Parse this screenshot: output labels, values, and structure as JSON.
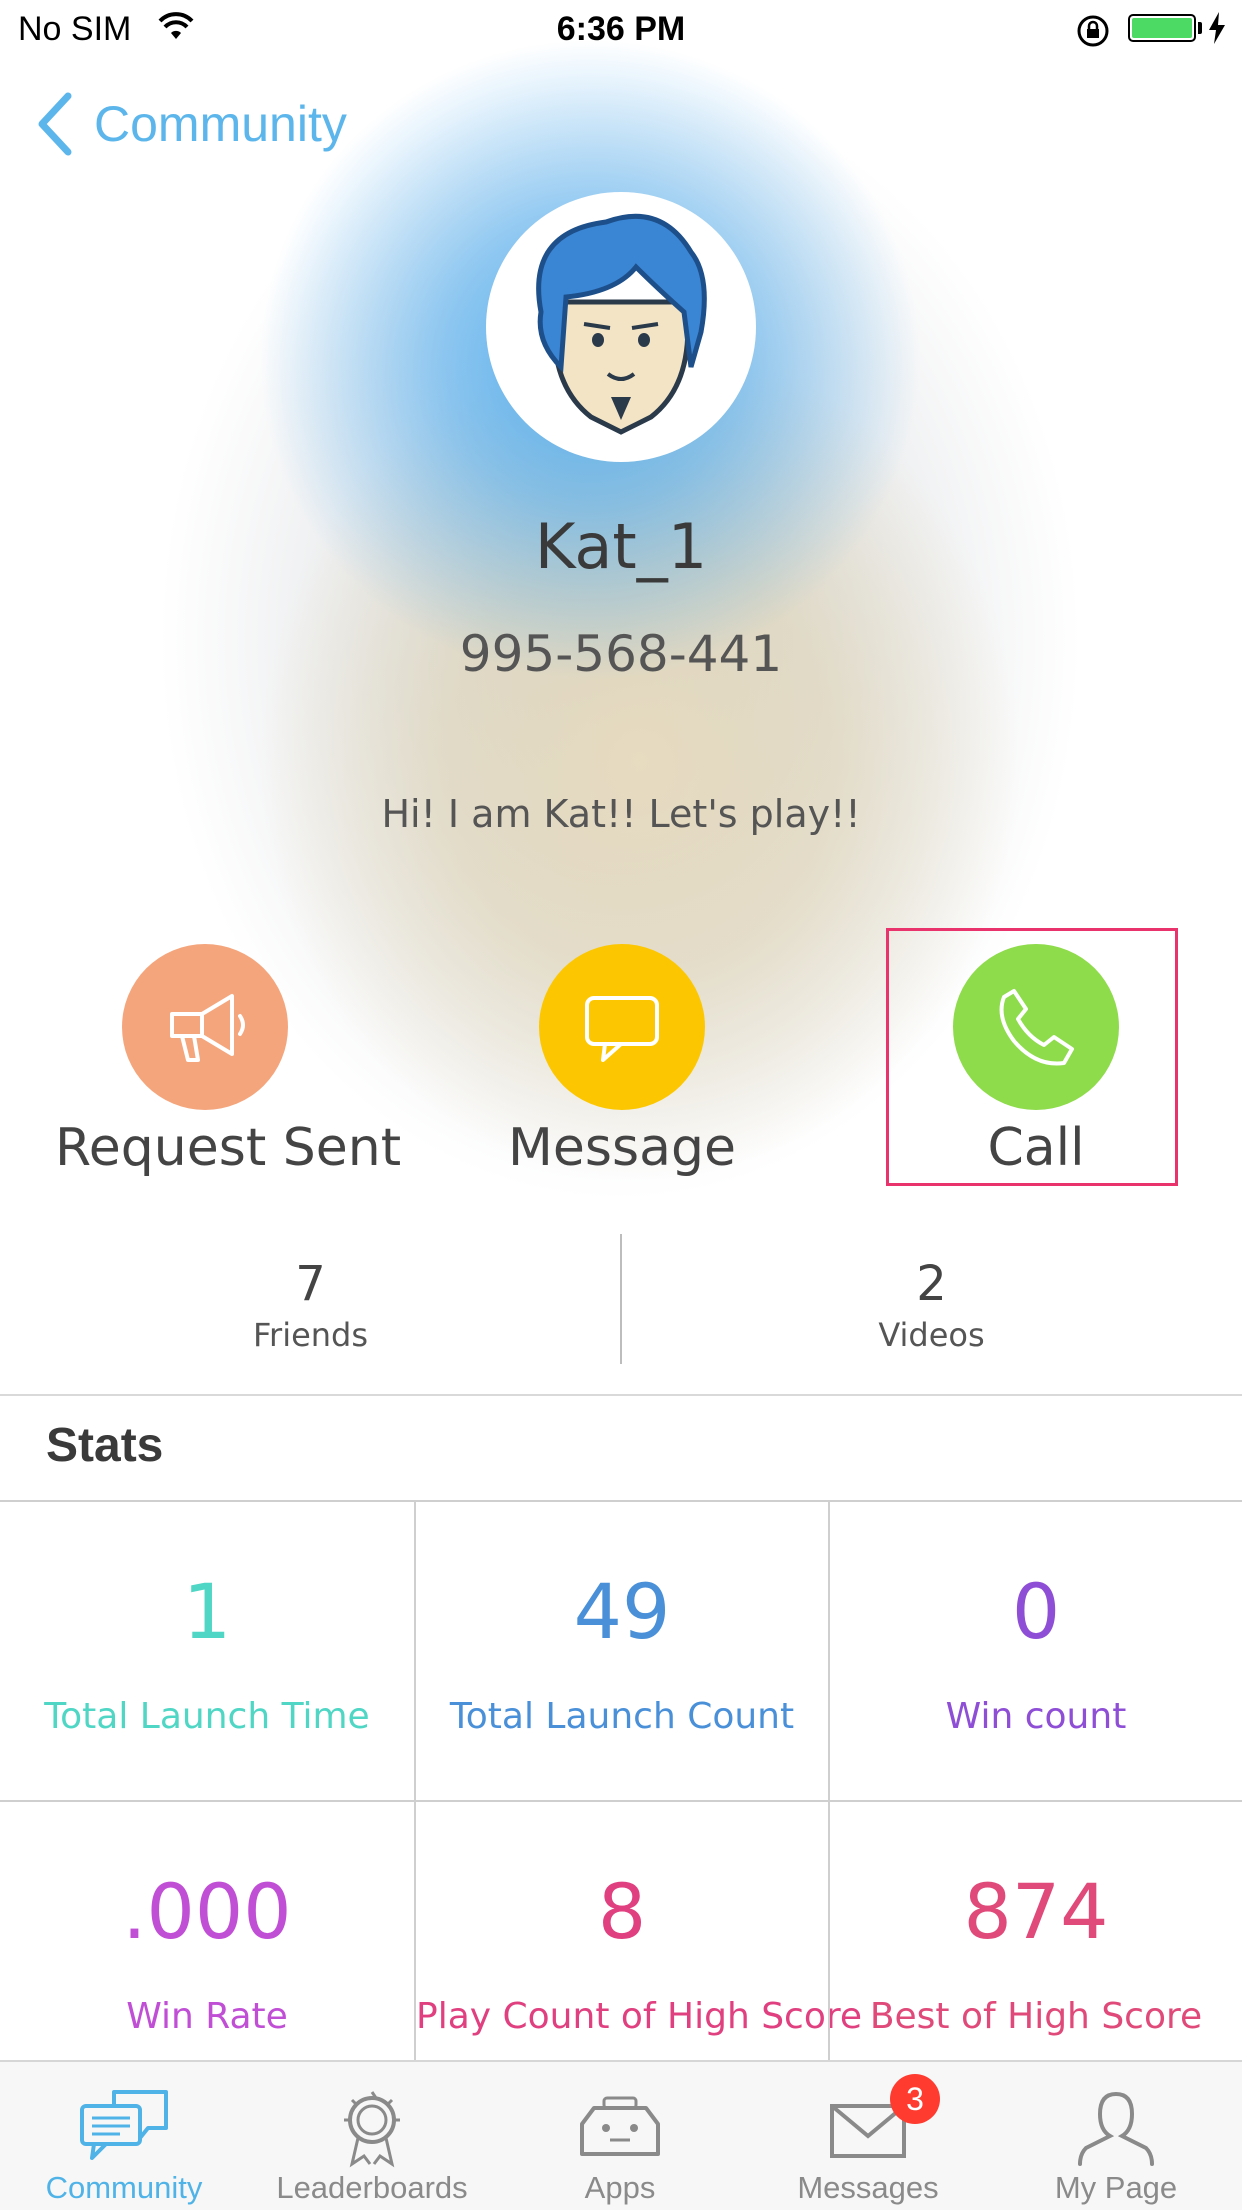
{
  "status_bar": {
    "carrier": "No SIM",
    "time": "6:36 PM"
  },
  "nav": {
    "back_label": "Community"
  },
  "profile": {
    "name": "Kat_1",
    "phone": "995-568-441",
    "bio": "Hi! I am Kat!! Let's play!!",
    "avatar_icon": "avatar-blue-hair"
  },
  "actions": [
    {
      "label": "Request Sent",
      "icon": "megaphone-icon",
      "color": "#f4a57c"
    },
    {
      "label": "Message",
      "icon": "speech-bubble-icon",
      "color": "#fcc700"
    },
    {
      "label": "Call",
      "icon": "phone-icon",
      "color": "#8edb4b"
    }
  ],
  "counts": [
    {
      "value": "7",
      "label": "Friends"
    },
    {
      "value": "2",
      "label": "Videos"
    }
  ],
  "stats": {
    "title": "Stats",
    "items": [
      {
        "value": "1",
        "label": "Total Launch Time",
        "color": "#4fd6c4"
      },
      {
        "value": "49",
        "label": "Total Launch Count",
        "color": "#4a90d9"
      },
      {
        "value": "0",
        "label": "Win count",
        "color": "#8e4fd6"
      },
      {
        "value": ".000",
        "label": "Win Rate",
        "color": "#c04fd6"
      },
      {
        "value": "8",
        "label": "Play Count of High Score",
        "color": "#e0407f"
      },
      {
        "value": "874",
        "label": "Best of High Score",
        "color": "#e04a7a"
      }
    ]
  },
  "tabbar": {
    "tabs": [
      {
        "label": "Community",
        "icon": "community-icon",
        "active": true
      },
      {
        "label": "Leaderboards",
        "icon": "leaderboards-icon",
        "active": false
      },
      {
        "label": "Apps",
        "icon": "apps-icon",
        "active": false
      },
      {
        "label": "Messages",
        "icon": "messages-icon",
        "active": false,
        "badge": "3"
      },
      {
        "label": "My Page",
        "icon": "my-page-icon",
        "active": false
      }
    ]
  },
  "colors": {
    "accent": "#4fb3e8",
    "highlight_border": "#e8336c"
  }
}
